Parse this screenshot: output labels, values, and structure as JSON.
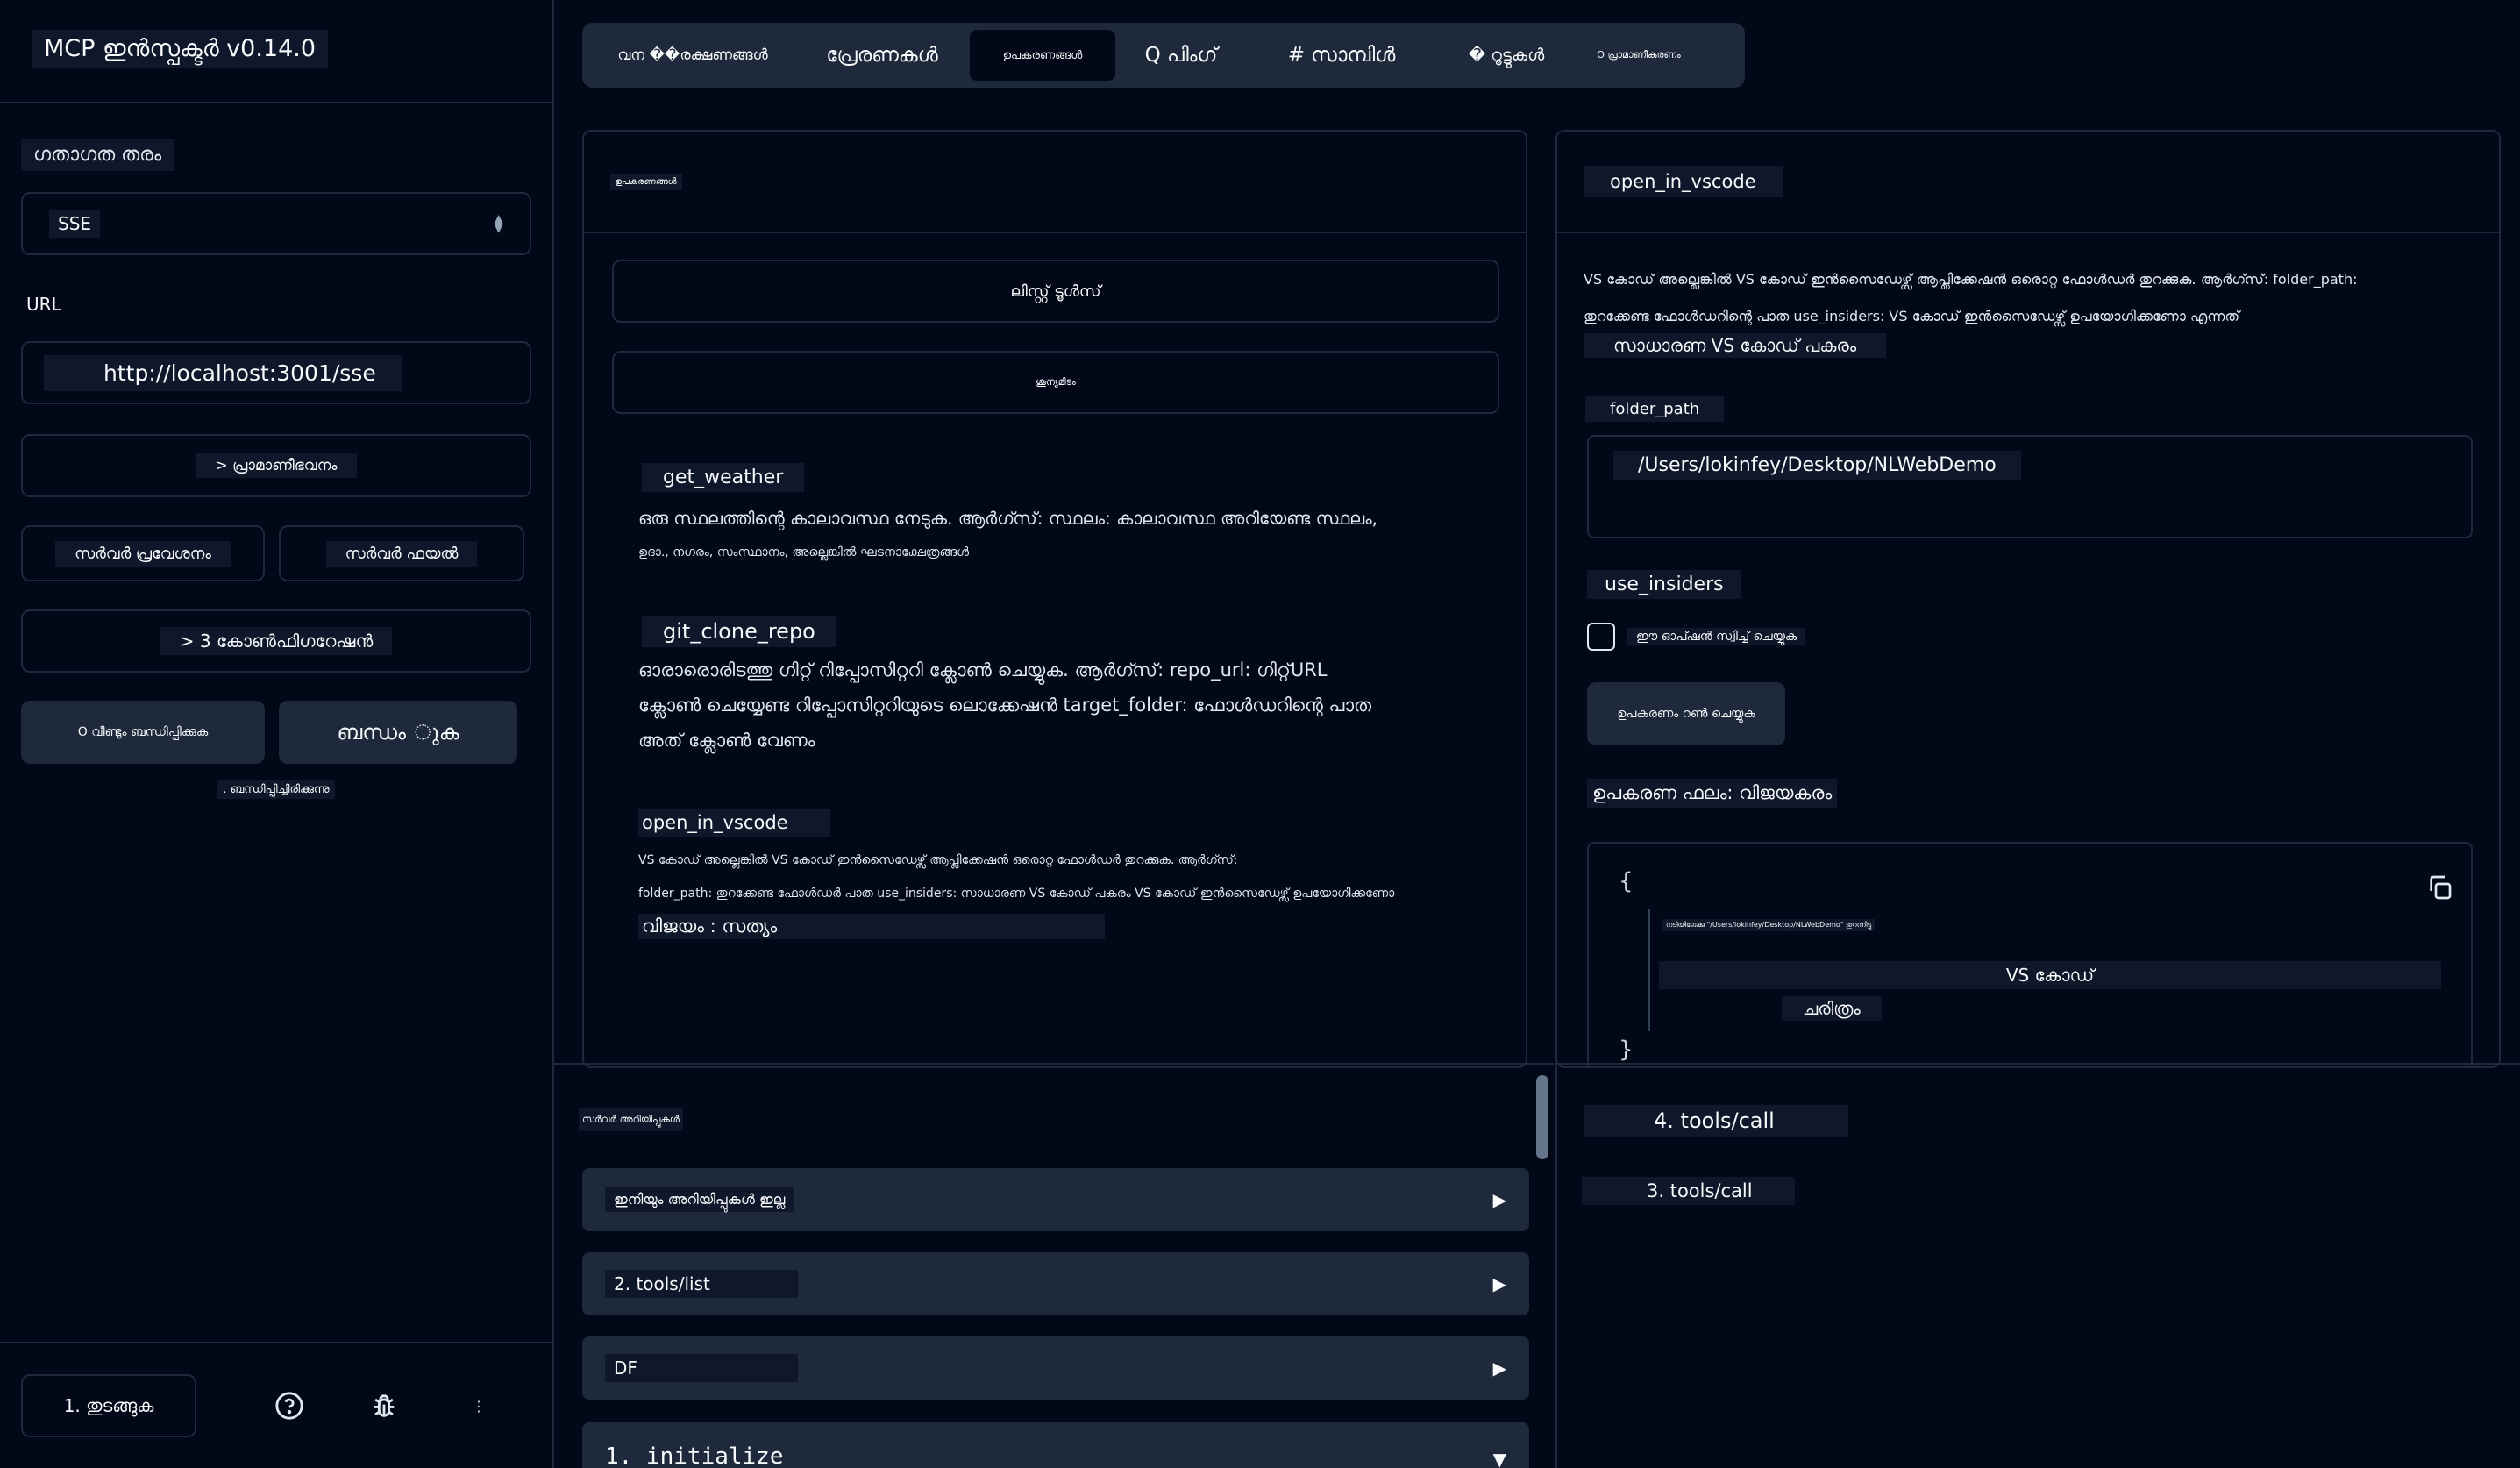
{
  "app": {
    "title": "MCP ഇൻസ്പക്ടർ v0.14.0"
  },
  "sidebar": {
    "transport_label": "ഗതാഗത തരം",
    "transport_value": "SSE",
    "url_label": "URL",
    "url_value": "http://localhost:3001/sse",
    "auth_button": "> പ്രാമാണീഭവനം",
    "env_button": "സർവർ പ്രവേശനം",
    "config_file_button": "സർവർ ഫയൽ",
    "configuration_button": "> 3 കോൺഫിഗറേഷൻ",
    "reconnect_button": "O വീണ്ടും ബന്ധിപ്പിക്കുക",
    "disconnect_button": "ബന്ധം ുക",
    "status_text": ". ബന്ധിപ്പിച്ചിരിക്കുന്നു",
    "footer": {
      "start_button": "1. തുടങ്ങുക",
      "help_icon": "help-circle-icon",
      "bug_icon": "bug-icon",
      "more_icon": "more-vertical-icon"
    }
  },
  "tabs": [
    {
      "label": "വന ��രക്ഷണങ്ങൾ",
      "active": false
    },
    {
      "label": "പ്രേരണകൾ",
      "active": false
    },
    {
      "label": "ഉപകരണങ്ങൾ",
      "active": true
    },
    {
      "label": "Q പിംഗ്",
      "active": false
    },
    {
      "label": "# സാമ്പിൾ",
      "active": false
    },
    {
      "label": "� റൂട്ടുകൾ",
      "active": false
    },
    {
      "label": "O പ്രാമാണീകരണം",
      "active": false
    }
  ],
  "tools_panel": {
    "title": "ഉപകരണങ്ങൾ",
    "list_button": "ലിസ്റ്റ് ടൂൾസ്",
    "clear_button": "ശൂന്യമിടം",
    "tools": [
      {
        "name": "get_weather",
        "desc_lines": [
          "ഒരു സ്ഥലത്തിന്റെ കാലാവസ്ഥ നേടുക. ആർഗ്സ്: സ്ഥലം: കാലാവസ്ഥ അറിയേണ്ട സ്ഥലം,",
          "ഉദാ., നഗരം, സംസ്ഥാനം, അല്ലെങ്കിൽ ഘടനാക്ഷേത്രങ്ങൾ"
        ]
      },
      {
        "name": "git_clone_repo",
        "desc_lines": [
          "ഓരാരൊരിടത്തു ഗിറ്റ് റിപ്പോസിറ്ററി ക്ലോൺ ചെയ്യുക. ആർഗ്സ്: repo_url: ഗിറ്റ്URL",
          "ക്ലോൺ ചെയ്യേണ്ട റിപ്പോസിറ്ററിയുടെ ലൊക്കേഷൻ target_folder: ഫോൾഡറിന്റെ പാത",
          "അത് ക്ലോൺ വേണം"
        ]
      },
      {
        "name": "open_in_vscode",
        "desc_lines": [
          "VS കോഡ് അല്ലെങ്കിൽ VS കോഡ് ഇൻസൈഡേഴ്സ് ആപ്ലിക്കേഷൻ ഒരൊറ്റ ഫോൾഡർ തുറക്കുക. ആർഗ്സ്:",
          "folder_path: തുറക്കേണ്ട ഫോൾഡർ പാത use_insiders: സാധാരണ VS കോഡ് പകരം VS കോഡ് ഇൻസൈഡേഴ്സ് ഉപയോഗിക്കണോ"
        ],
        "extra": "വിജയം : സത്യം"
      }
    ]
  },
  "detail_panel": {
    "title": "open_in_vscode",
    "desc_lines": [
      "VS കോഡ് അല്ലെങ്കിൽ VS കോഡ് ഇൻസൈഡേഴ്സ് ആപ്ലിക്കേഷൻ ഒരൊറ്റ ഫോൾഡർ തുറക്കുക. ആർഗ്സ്: folder_path:",
      "തുറക്കേണ്ട ഫോൾഡറിന്റെ പാത use_insiders: VS കോഡ് ഇൻസൈഡേഴ്സ് ഉപയോഗിക്കണോ എന്നത്",
      "സാധാരണ VS കോഡ് പകരം"
    ],
    "folder_path_label": "folder_path",
    "folder_path_value": "/Users/lokinfey/Desktop/NLWebDemo",
    "use_insiders_label": "use_insiders",
    "checkbox_label": "ഈ ഓപ്ഷൻ സ്വിച്ച് ചെയ്യുക",
    "run_button": "ഉപകരണം റൺ ചെയ്യുക",
    "result_label": "ഉപകരണ ഫലം: വിജയകരം",
    "result": {
      "open_brace": "{",
      "line1": "നടിയിലേക്കു \"/Users/lokinfey/Desktop/NLWebDemo\" തുറന്നിട്ടു",
      "line2": "VS കോഡ്",
      "line3": "ചരിത്രം",
      "close_brace": "}"
    }
  },
  "history": {
    "title": "സർവർ അറിയിപ്പുകൾ",
    "rows": [
      {
        "label": "ഇനിയും അറിയിപ്പുകൾ ഇല്ല",
        "arrow": "▶"
      },
      {
        "label": "2. tools/list",
        "arrow": "▶"
      },
      {
        "label": "DF",
        "arrow": "▶"
      },
      {
        "label": "1. initialize",
        "arrow": "▼"
      }
    ]
  },
  "notifications": {
    "items": [
      "4. tools/call",
      "3. tools/call"
    ]
  }
}
